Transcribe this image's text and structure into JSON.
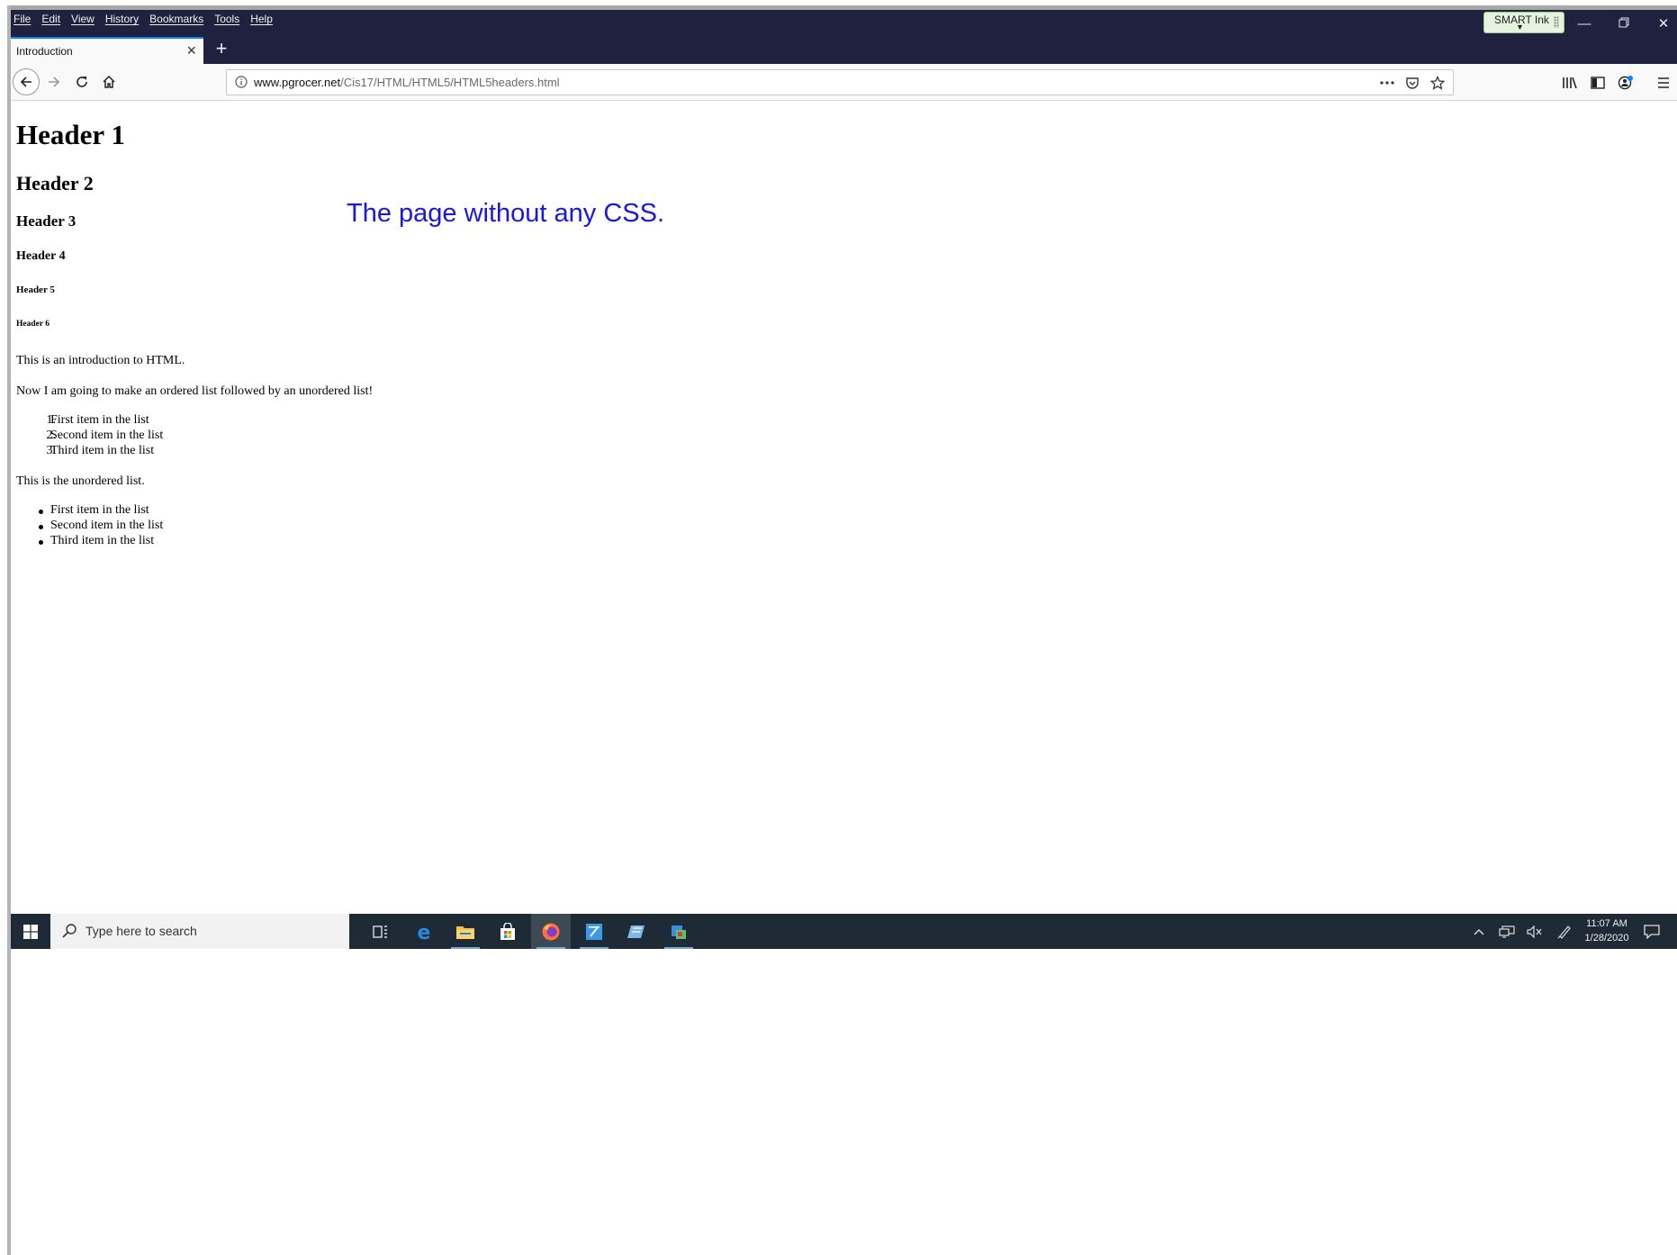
{
  "browser": {
    "menu": [
      "File",
      "Edit",
      "View",
      "History",
      "Bookmarks",
      "Tools",
      "Help"
    ],
    "smart_ink": "SMART Ink",
    "tab_title": "Introduction",
    "url_host": "www.pgrocer.net",
    "url_path": "/Cis17/HTML/HTML5/HTML5headers.html",
    "accent": "#0a84ff",
    "titlebar_color": "#20213f"
  },
  "page": {
    "h1": "Header 1",
    "h2": "Header 2",
    "h3": "Header 3",
    "h4": "Header 4",
    "h5": "Header 5",
    "h6": "Header 6",
    "intro": "This is an introduction to HTML.",
    "lists_intro": "Now I am going to make an ordered list followed by an unordered list!",
    "ordered_list": [
      {
        "marker": "1.",
        "text": "First item in the list"
      },
      {
        "marker": "2.",
        "text": "Second item in the list"
      },
      {
        "marker": "3.",
        "text": "Third item in the list"
      }
    ],
    "unordered_intro": "This is the unordered list.",
    "unordered_list": [
      "First item in the list",
      "Second item in the list",
      "Third item in the list"
    ],
    "annotation": "The page without any CSS.",
    "annotation_color": "#1a16e4"
  },
  "taskbar": {
    "search_placeholder": "Type here to search",
    "time": "11:07 AM",
    "date": "1/28/2020",
    "apps": [
      "task-view",
      "edge",
      "file-explorer",
      "store",
      "firefox",
      "notepad",
      "teams-note",
      "snipping"
    ]
  }
}
